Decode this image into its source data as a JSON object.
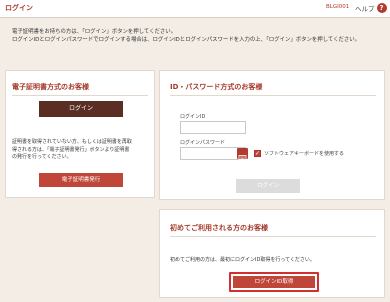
{
  "header": {
    "title": "ログイン",
    "screen_code": "BLGI001",
    "help_label": "ヘルプ",
    "help_icon": "?"
  },
  "intro": {
    "line1": "電子証明書をお持ちの方は、「ログイン」ボタンを押してください。",
    "line2": "ログインIDとログインパスワードでログインする場合は、ログインIDとログインパスワードを入力の上、「ログイン」ボタンを押してください。"
  },
  "cert_panel": {
    "title": "電子証明書方式のお客様",
    "login_button": "ログイン",
    "note_line1": "証明書を取得されていない方、もしくは証明書を再取",
    "note_line2": "得される方は、「電子証明書発行」ボタンより証明書",
    "note_line3": "の発行を行ってください。",
    "issue_button": "電子証明書発行"
  },
  "id_panel": {
    "title": "ID・パスワード方式のお客様",
    "id_label": "ログインID",
    "id_value": "",
    "password_label": "ログインパスワード",
    "password_value": "",
    "software_keyboard_label": "ソフトウェアキーボードを使用する",
    "software_keyboard_checked": true,
    "login_button": "ログイン"
  },
  "first_panel": {
    "title": "初めてご利用される方のお客様",
    "note": "初めてご利用の方は、最初にログインID取得を行ってください。",
    "get_id_button": "ログインID取得"
  },
  "colors": {
    "accent": "#a63a2c",
    "dark_button": "#5a2e23",
    "red_button": "#c0463a",
    "background": "#f3ede6"
  }
}
